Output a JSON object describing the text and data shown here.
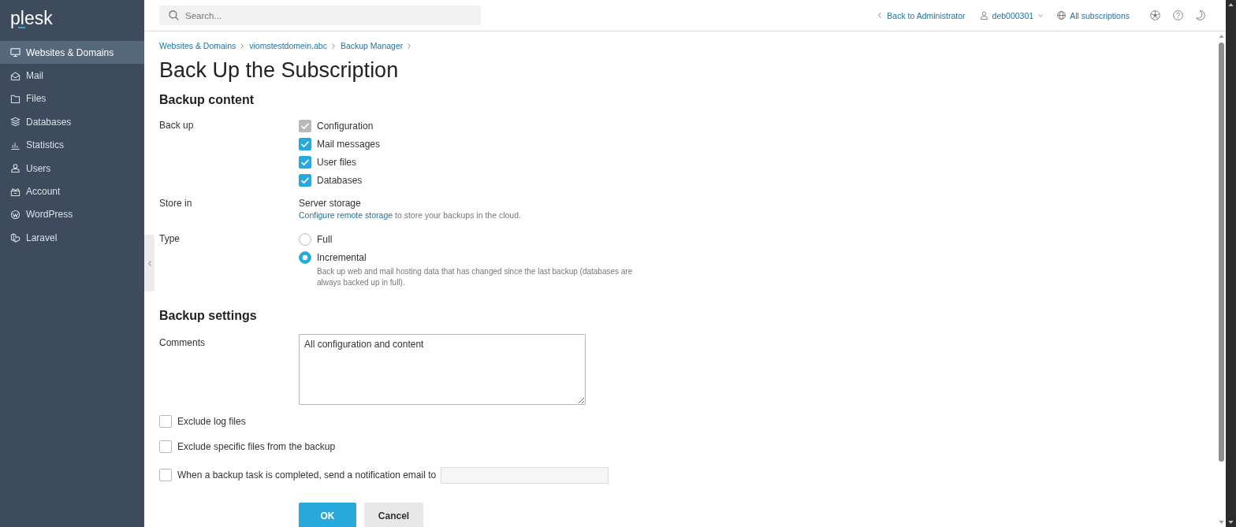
{
  "sidebar": {
    "logo": "plesk",
    "items": [
      {
        "label": "Websites & Domains",
        "selected": true
      },
      {
        "label": "Mail",
        "selected": false
      },
      {
        "label": "Files",
        "selected": false
      },
      {
        "label": "Databases",
        "selected": false
      },
      {
        "label": "Statistics",
        "selected": false
      },
      {
        "label": "Users",
        "selected": false
      },
      {
        "label": "Account",
        "selected": false
      },
      {
        "label": "WordPress",
        "selected": false
      },
      {
        "label": "Laravel",
        "selected": false
      }
    ]
  },
  "header": {
    "search": {
      "placeholder": "Search..."
    },
    "back_link": "Back to Administrator",
    "user": "deb000301",
    "subscriptions": "All subscriptions"
  },
  "breadcrumbs": [
    "Websites & Domains",
    "viomstestdomein.abc",
    "Backup Manager"
  ],
  "title": "Back Up the Subscription",
  "backup_content": {
    "heading": "Backup content",
    "back_up": {
      "label": "Back up",
      "options": [
        {
          "label": "Configuration",
          "checked": true,
          "disabled": true
        },
        {
          "label": "Mail messages",
          "checked": true,
          "disabled": false
        },
        {
          "label": "User files",
          "checked": true,
          "disabled": false
        },
        {
          "label": "Databases",
          "checked": true,
          "disabled": false
        }
      ]
    },
    "store_in": {
      "label": "Store in",
      "value": "Server storage",
      "link": "Configure remote storage",
      "note": "to store your backups in the cloud."
    },
    "type": {
      "label": "Type",
      "options": [
        {
          "label": "Full",
          "selected": false
        },
        {
          "label": "Incremental",
          "selected": true
        }
      ],
      "description": "Back up web and mail hosting data that has changed since the last backup (databases are always backed up in full)."
    }
  },
  "backup_settings": {
    "heading": "Backup settings",
    "comments": {
      "label": "Comments",
      "value": "All configuration and content"
    },
    "options": [
      {
        "label": "Exclude log files",
        "checked": false,
        "kind": "plain"
      },
      {
        "label": "Exclude specific files from the backup",
        "checked": false,
        "kind": "plain"
      },
      {
        "label": "When a backup task is completed, send a notification email to",
        "checked": false,
        "kind": "email"
      }
    ]
  },
  "buttons": [
    {
      "label": "OK",
      "kind": "primary"
    },
    {
      "label": "Cancel",
      "kind": "secondary"
    }
  ]
}
